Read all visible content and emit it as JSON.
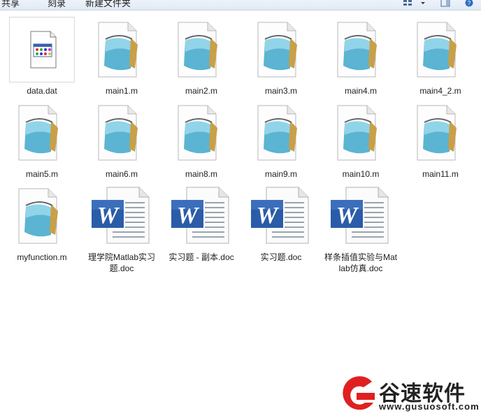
{
  "toolbar": {
    "share_label": "共享",
    "burn_label": "刻录",
    "new_folder_label": "新建文件夹"
  },
  "files": [
    {
      "name": "data.dat",
      "type": "dat-icon"
    },
    {
      "name": "main1.m",
      "type": "m-file-icon"
    },
    {
      "name": "main2.m",
      "type": "m-file-icon"
    },
    {
      "name": "main3.m",
      "type": "m-file-icon"
    },
    {
      "name": "main4.m",
      "type": "m-file-icon"
    },
    {
      "name": "main4_2.m",
      "type": "m-file-icon"
    },
    {
      "name": "main5.m",
      "type": "m-file-icon"
    },
    {
      "name": "main6.m",
      "type": "m-file-icon"
    },
    {
      "name": "main8.m",
      "type": "m-file-icon"
    },
    {
      "name": "main9.m",
      "type": "m-file-icon"
    },
    {
      "name": "main10.m",
      "type": "m-file-icon"
    },
    {
      "name": "main11.m",
      "type": "m-file-icon"
    },
    {
      "name": "myfunction.m",
      "type": "m-file-icon"
    },
    {
      "name": "理学院Matlab实习题.doc",
      "type": "word-doc-icon"
    },
    {
      "name": "实习题 - 副本.doc",
      "type": "word-doc-icon"
    },
    {
      "name": "实习题.doc",
      "type": "word-doc-icon"
    },
    {
      "name": "样条插值实验与Matlab仿真.doc",
      "type": "word-doc-icon"
    }
  ],
  "watermark": {
    "brand": "谷速软件",
    "url": "www.gusuosoft.com",
    "colors": {
      "logo_red": "#e02020",
      "text": "#222222"
    }
  }
}
